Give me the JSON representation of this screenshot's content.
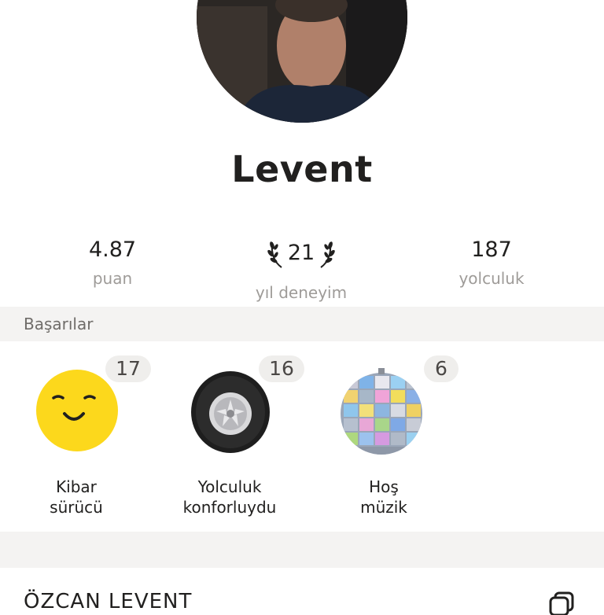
{
  "driver": {
    "name": "Levent",
    "avatar_icon": "driver-photo"
  },
  "stats": [
    {
      "value": "4.87",
      "label": "puan"
    },
    {
      "value": "21",
      "label": "yıl deneyim"
    },
    {
      "value": "187",
      "label": "yolculuk"
    }
  ],
  "achievements": {
    "title": "Başarılar",
    "items": [
      {
        "count": "17",
        "line1": "Kibar",
        "line2": "sürücü",
        "icon": "smiley-icon"
      },
      {
        "count": "16",
        "line1": "Yolculuk",
        "line2": "konforluydu",
        "icon": "tire-icon"
      },
      {
        "count": "6",
        "line1": "Hoş",
        "line2": "müzik",
        "icon": "disco-ball-icon"
      }
    ]
  },
  "company": {
    "name": "ÖZCAN LEVENT",
    "action_icon": "copy-icon"
  },
  "colors": {
    "text": "#21201f",
    "muted": "#9e9b98",
    "band": "#f4f3f2",
    "badge_bg": "#efeeec",
    "smiley": "#fcd81c"
  }
}
